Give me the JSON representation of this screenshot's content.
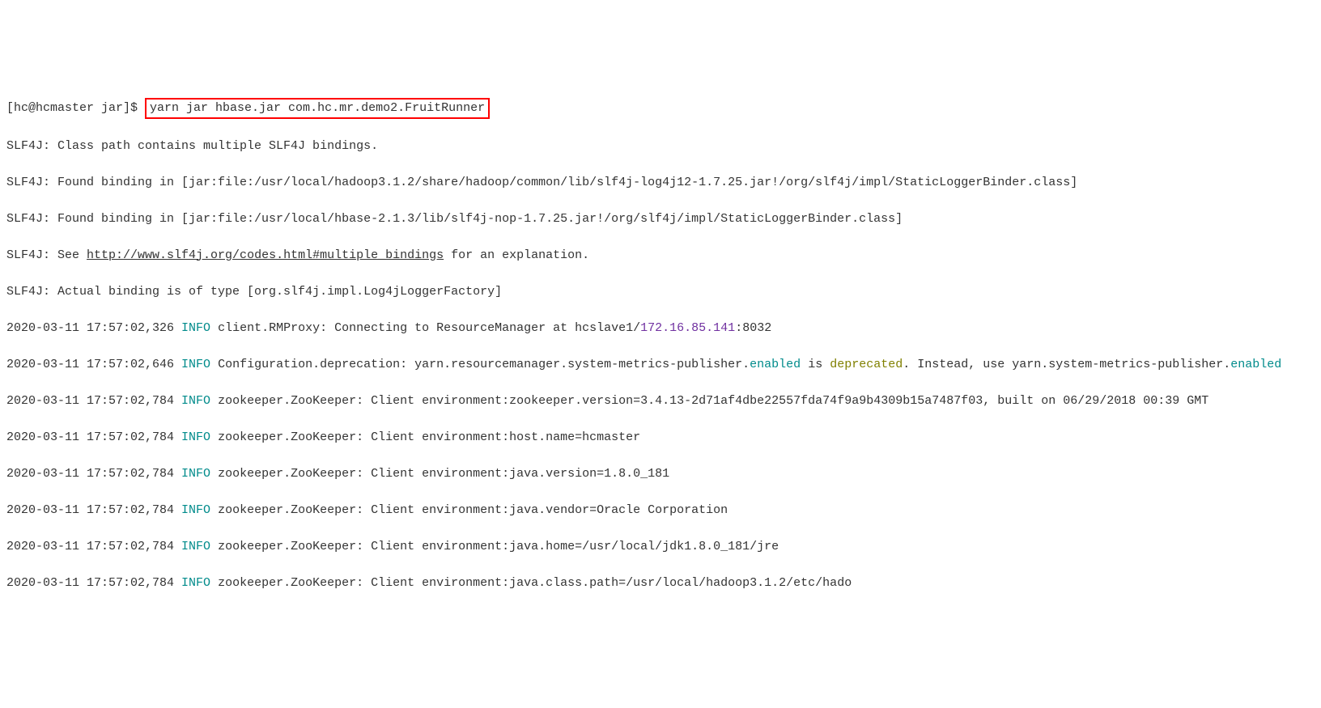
{
  "prompt": "[hc@hcmaster jar]$ ",
  "command": "yarn jar hbase.jar com.hc.mr.demo2.FruitRunner",
  "lines": {
    "l1": "SLF4J: Class path contains multiple SLF4J bindings.",
    "l2": "SLF4J: Found binding in [jar:file:/usr/local/hadoop3.1.2/share/hadoop/common/lib/slf4j-log4j12-1.7.25.jar!/org/slf4j/impl/StaticLoggerBinder.class]",
    "l3": "SLF4J: Found binding in [jar:file:/usr/local/hbase-2.1.3/lib/slf4j-nop-1.7.25.jar!/org/slf4j/impl/StaticLoggerBinder.class]",
    "l4_pre": "SLF4J: See ",
    "l4_link": "http://www.slf4j.org/codes.html#multiple_bindings",
    "l4_post": " for an explanation.",
    "l5": "SLF4J: Actual binding is of type [org.slf4j.impl.Log4jLoggerFactory]",
    "l6_a": "2020-03-11 17:57:02,326 ",
    "l6_info": "INFO",
    "l6_b": " client.RMProxy: Connecting to ResourceManager at hcslave1/",
    "l6_ip": "172.16.85.141",
    "l6_c": ":8032",
    "l7_a": "2020-03-11 17:57:02,646 ",
    "l7_info": "INFO",
    "l7_b": " Configuration.deprecation: yarn.resourcemanager.system-metrics-publisher.",
    "l7_enabled1": "enabled",
    "l7_c": " is ",
    "l7_dep": "deprecated",
    "l7_d": ". Instead, use yarn.system-metrics-publisher.",
    "l7_enabled2": "enabled",
    "l8_a": "2020-03-11 17:57:02,784 ",
    "l8_info": "INFO",
    "l8_b": " zookeeper.ZooKeeper: Client environment:zookeeper.version=3.4.13-2d71af4dbe22557fda74f9a9b4309b15a7487f03, built on 06/29/2018 00:39 GMT",
    "l9_a": "2020-03-11 17:57:02,784 ",
    "l9_info": "INFO",
    "l9_b": " zookeeper.ZooKeeper: Client environment:host.name=hcmaster",
    "l10_a": "2020-03-11 17:57:02,784 ",
    "l10_info": "INFO",
    "l10_b": " zookeeper.ZooKeeper: Client environment:java.version=1.8.0_181",
    "l11_a": "2020-03-11 17:57:02,784 ",
    "l11_info": "INFO",
    "l11_b": " zookeeper.ZooKeeper: Client environment:java.vendor=Oracle Corporation",
    "l12_a": "2020-03-11 17:57:02,784 ",
    "l12_info": "INFO",
    "l12_b": " zookeeper.ZooKeeper: Client environment:java.home=/usr/local/jdk1.8.0_181/jre",
    "l13_a": "2020-03-11 17:57:02,784 ",
    "l13_info": "INFO",
    "l13_b": " zookeeper.ZooKeeper: Client environment:java.class.path=/usr/local/hadoop3.1.2/etc/hado"
  }
}
